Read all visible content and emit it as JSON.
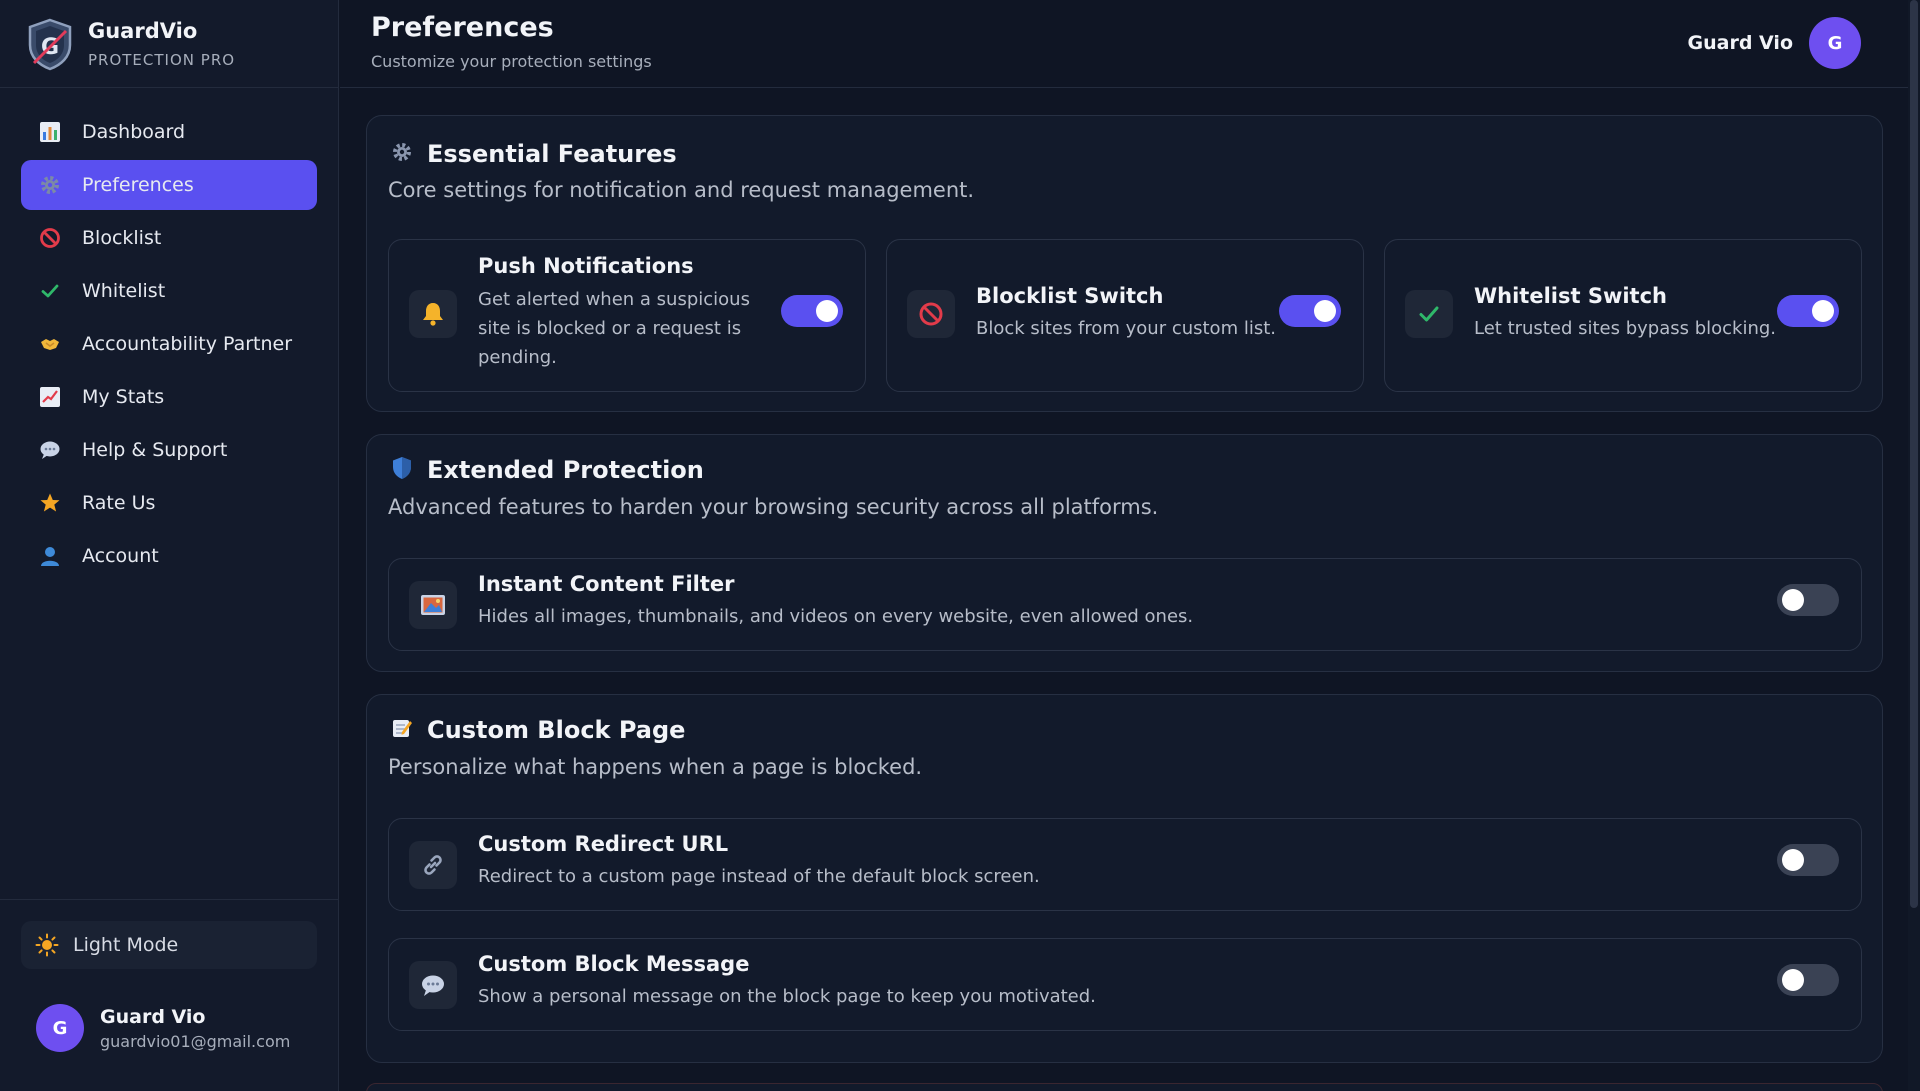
{
  "brand": {
    "name": "GuardVio",
    "subtitle": "PROTECTION PRO"
  },
  "nav": [
    {
      "label": "Dashboard",
      "icon": "bar-chart-icon"
    },
    {
      "label": "Preferences",
      "icon": "gear-icon",
      "active": true
    },
    {
      "label": "Blocklist",
      "icon": "prohibited-icon"
    },
    {
      "label": "Whitelist",
      "icon": "check-icon"
    },
    {
      "label": "Accountability Partner",
      "icon": "handshake-icon"
    },
    {
      "label": "My Stats",
      "icon": "trend-chart-icon"
    },
    {
      "label": "Help & Support",
      "icon": "speech-bubble-icon"
    },
    {
      "label": "Rate Us",
      "icon": "star-icon"
    },
    {
      "label": "Account",
      "icon": "user-icon"
    }
  ],
  "sidebar_footer": {
    "mode_label": "Light Mode",
    "user_initial": "G",
    "user_name": "Guard Vio",
    "user_email": "guardvio01@gmail.com"
  },
  "header": {
    "title": "Preferences",
    "subtitle": "Customize your protection settings",
    "user_name": "Guard Vio",
    "user_initial": "G"
  },
  "sections": {
    "essential": {
      "title": "Essential Features",
      "description": "Core settings for notification and request management.",
      "cards": [
        {
          "title": "Push Notifications",
          "line1": "Get alerted when a suspicious",
          "line2": "site is blocked or a request is",
          "line3": "pending.",
          "enabled": true,
          "icon": "bell-icon"
        },
        {
          "title": "Blocklist Switch",
          "description": "Block sites from your custom list.",
          "enabled": true,
          "icon": "prohibited-icon"
        },
        {
          "title": "Whitelist Switch",
          "description": "Let trusted sites bypass blocking.",
          "enabled": true,
          "icon": "check-icon"
        }
      ]
    },
    "extended": {
      "title": "Extended Protection",
      "description": "Advanced features to harden your browsing security across all platforms.",
      "cards": [
        {
          "title": "Instant Content Filter",
          "description": "Hides all images, thumbnails, and videos on every website, even allowed ones.",
          "enabled": false,
          "icon": "picture-icon"
        }
      ]
    },
    "custom": {
      "title": "Custom Block Page",
      "description": "Personalize what happens when a page is blocked.",
      "cards": [
        {
          "title": "Custom Redirect URL",
          "description": "Redirect to a custom page instead of the default block screen.",
          "enabled": false,
          "icon": "link-icon"
        },
        {
          "title": "Custom Block Message",
          "description": "Show a personal message on the block page to keep you motivated.",
          "enabled": false,
          "icon": "speech-bubble-icon"
        }
      ]
    }
  },
  "colors": {
    "accent": "#5a50f0",
    "background": "#0f1524",
    "panel": "#121a2b",
    "toggle_off": "#3a4254"
  }
}
